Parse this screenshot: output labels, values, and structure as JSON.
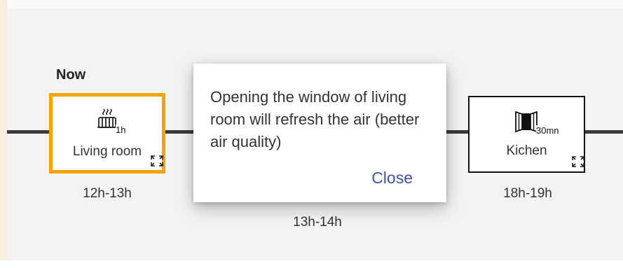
{
  "timeline": {
    "now_label": "Now",
    "slots": [
      {
        "room": "Living room",
        "duration": "1h",
        "time": "12h-13h",
        "icon": "radiator-heat-icon",
        "active": true
      },
      {
        "time": "13h-14h"
      },
      {
        "room": "Kichen",
        "duration": "30mn",
        "time": "18h-19h",
        "icon": "open-window-icon",
        "active": false
      }
    ]
  },
  "dialog": {
    "message": "Opening the window of living room will refresh the air (better air quality)",
    "close_label": "Close"
  },
  "colors": {
    "active_border": "#f5a400",
    "link": "#3f51b5",
    "timeline": "#3a3a3a"
  }
}
